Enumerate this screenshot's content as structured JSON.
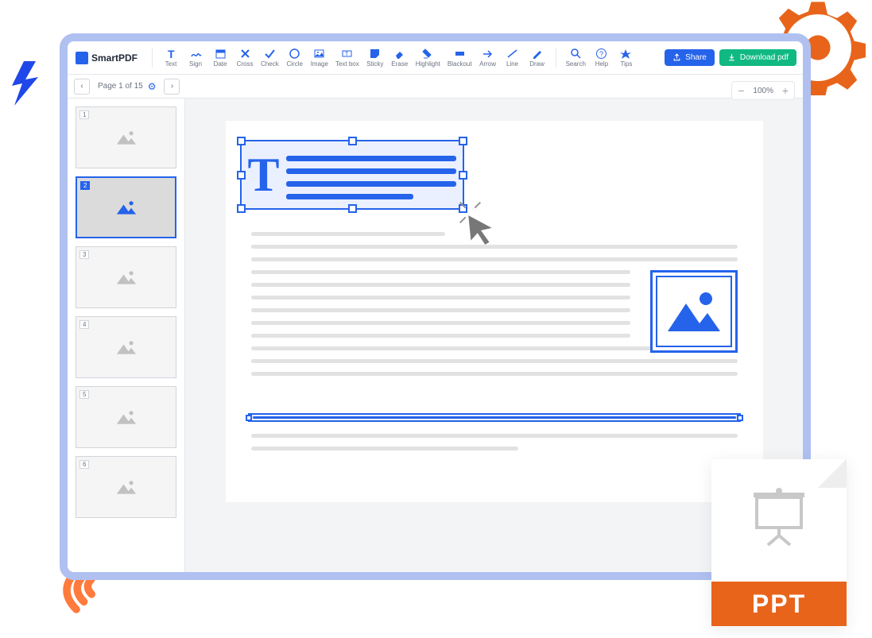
{
  "brand": "SmartPDF",
  "tools": [
    {
      "label": "Text",
      "icon": "T"
    },
    {
      "label": "Sign",
      "icon": "sign"
    },
    {
      "label": "Date",
      "icon": "date"
    },
    {
      "label": "Cross",
      "icon": "cross"
    },
    {
      "label": "Check",
      "icon": "check"
    },
    {
      "label": "Circle",
      "icon": "circle"
    },
    {
      "label": "Image",
      "icon": "image"
    },
    {
      "label": "Text box",
      "icon": "textbox"
    },
    {
      "label": "Sticky",
      "icon": "sticky"
    },
    {
      "label": "Erase",
      "icon": "erase"
    },
    {
      "label": "Highlight",
      "icon": "highlight"
    },
    {
      "label": "Blackout",
      "icon": "blackout"
    },
    {
      "label": "Arrow",
      "icon": "arrow"
    },
    {
      "label": "Line",
      "icon": "line"
    },
    {
      "label": "Draw",
      "icon": "draw"
    }
  ],
  "utilTools": [
    {
      "label": "Search",
      "icon": "search"
    },
    {
      "label": "Help",
      "icon": "help"
    },
    {
      "label": "Tips",
      "icon": "tips"
    }
  ],
  "share": "Share",
  "download": "Download pdf",
  "pageInfo": "Page 1 of 15",
  "zoom": "100%",
  "thumbs": [
    1,
    2,
    3,
    4,
    5,
    6
  ],
  "activeThumb": 2,
  "fileLabel": "PPT"
}
